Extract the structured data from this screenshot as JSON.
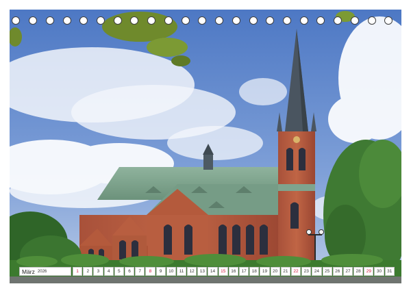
{
  "calendar": {
    "month_label": "März",
    "year_label": "2026",
    "days": [
      "1",
      "2",
      "3",
      "4",
      "5",
      "6",
      "7",
      "8",
      "9",
      "10",
      "11",
      "12",
      "13",
      "14",
      "15",
      "16",
      "17",
      "18",
      "19",
      "20",
      "21",
      "22",
      "23",
      "24",
      "25",
      "26",
      "27",
      "28",
      "29",
      "30",
      "31"
    ],
    "sunday_days": [
      "1",
      "8",
      "15",
      "22",
      "29"
    ],
    "ring_count": 23
  },
  "colors": {
    "sky": "#5f86c9",
    "brick": "#b45a3c",
    "roof": "#7fa48e",
    "spire": "#4a5560",
    "foliage": "#3f7a33",
    "sunday_text": "#d2143a",
    "ring": "#3d3d3d"
  },
  "icons": {
    "binding": "spiral-ring-icon"
  }
}
